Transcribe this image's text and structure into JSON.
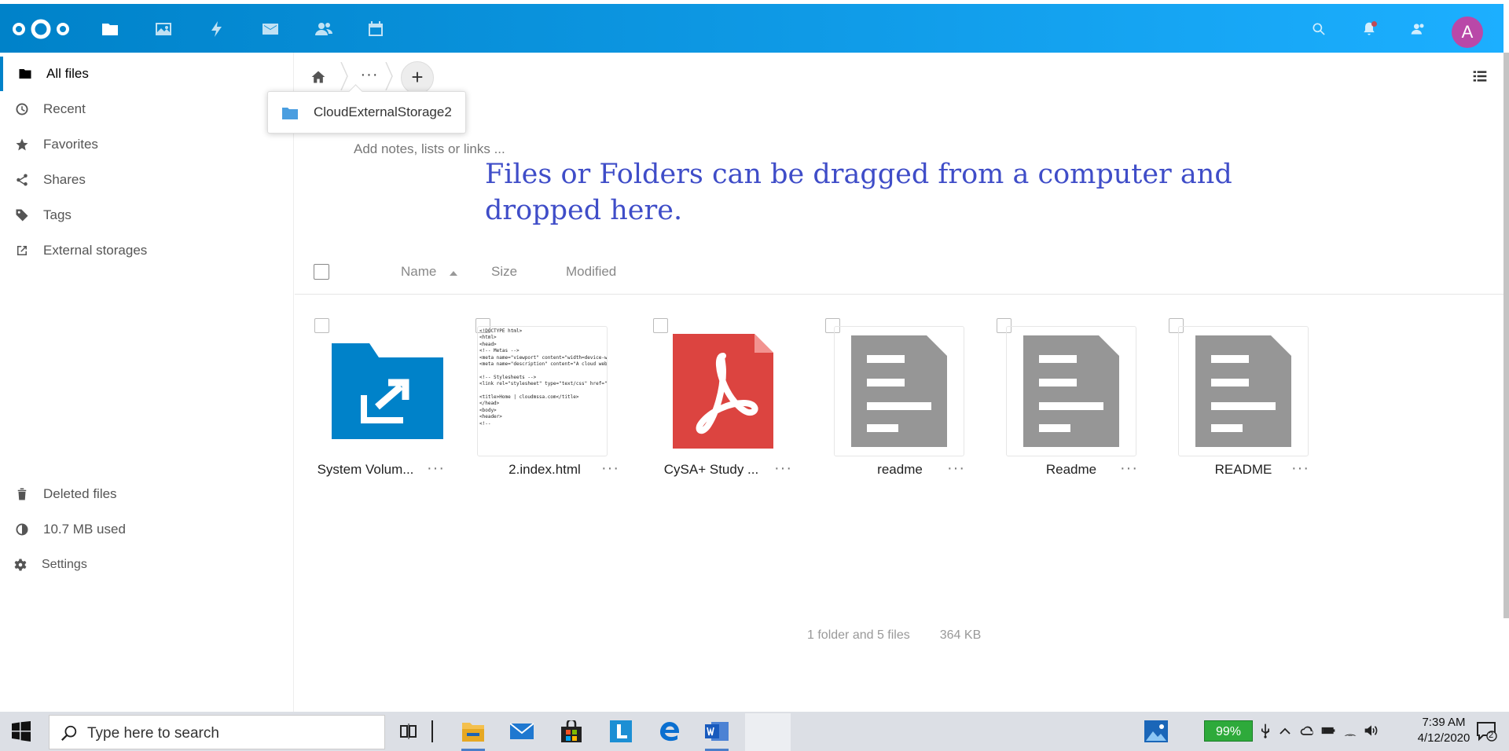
{
  "header": {
    "apps": [
      {
        "name": "files",
        "icon": "folder-icon",
        "active": true
      },
      {
        "name": "photos",
        "icon": "image-icon",
        "active": false
      },
      {
        "name": "activity",
        "icon": "lightning-icon",
        "active": false
      },
      {
        "name": "mail",
        "icon": "envelope-icon",
        "active": false
      },
      {
        "name": "contacts",
        "icon": "contacts-icon",
        "active": false
      },
      {
        "name": "calendar",
        "icon": "calendar-icon",
        "active": false
      }
    ],
    "avatar_letter": "A",
    "colors": {
      "header_start": "#0082c9",
      "header_end": "#1cafff",
      "avatar": "#b948a8"
    }
  },
  "sidebar": {
    "items": [
      {
        "label": "All files",
        "icon": "folder-icon",
        "active": true
      },
      {
        "label": "Recent",
        "icon": "clock-icon"
      },
      {
        "label": "Favorites",
        "icon": "star-icon"
      },
      {
        "label": "Shares",
        "icon": "share-icon"
      },
      {
        "label": "Tags",
        "icon": "tag-icon"
      },
      {
        "label": "External storages",
        "icon": "external-link-icon"
      }
    ],
    "bottom": {
      "deleted": "Deleted files",
      "quota": "10.7 MB used",
      "settings": "Settings"
    }
  },
  "breadcrumb": {
    "more": "···",
    "add": "+",
    "popover_item": "CloudExternalStorage2"
  },
  "notes_placeholder": "Add notes, lists or links ...",
  "drop_hint": "Files or Folders can be dragged from a computer and dropped here.",
  "columns": {
    "name": "Name",
    "size": "Size",
    "modified": "Modified"
  },
  "files": [
    {
      "name": "System Volum...",
      "type": "external-folder"
    },
    {
      "name": "2.index.html",
      "type": "html"
    },
    {
      "name": "CySA+ Study ...",
      "type": "pdf"
    },
    {
      "name": "readme",
      "type": "text"
    },
    {
      "name": "Readme",
      "type": "text"
    },
    {
      "name": "README",
      "type": "text"
    }
  ],
  "html_preview_lines": [
    "<!DOCTYPE html>",
    "<html>",
    "<head>",
    "<!-- Metas -->",
    "<meta name=\"viewport\" content=\"width=device-w",
    "<meta name=\"description\" content=\"A cloud web",
    "",
    "<!-- Stylesheets -->",
    "<link rel=\"stylesheet\" type=\"text/css\" href=\"css/sty",
    "",
    "<title>Home | cloudmssa.com</title>",
    "</head>",
    "<body>",
    "<header>",
    "<!--"
  ],
  "summary": {
    "counts": "1 folder and 5 files",
    "size": "364 KB"
  },
  "taskbar": {
    "search_placeholder": "Type here to search",
    "battery": "99%",
    "time": "7:39 AM",
    "date": "4/12/2020",
    "notifications": "2"
  }
}
